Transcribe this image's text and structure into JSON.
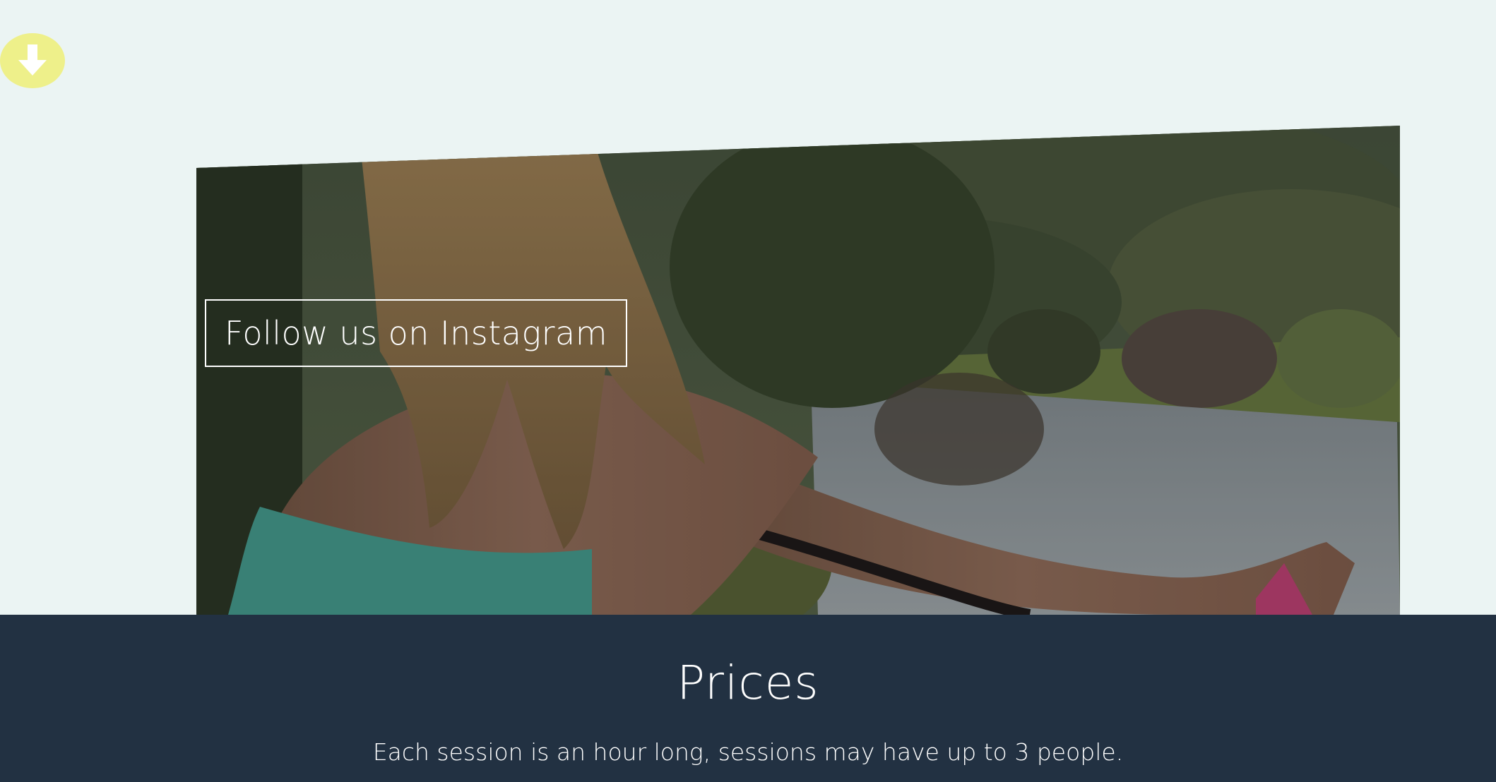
{
  "scroll_button": {
    "icon": "arrow-down-icon",
    "color": "#eef08a"
  },
  "photo": {
    "description_icon": "hero-photo"
  },
  "instagram": {
    "label": "Follow us on Instagram"
  },
  "prices": {
    "title": "Prices",
    "description": "Each session is an hour long, sessions may have up to 3 people.",
    "background": "#223142"
  }
}
